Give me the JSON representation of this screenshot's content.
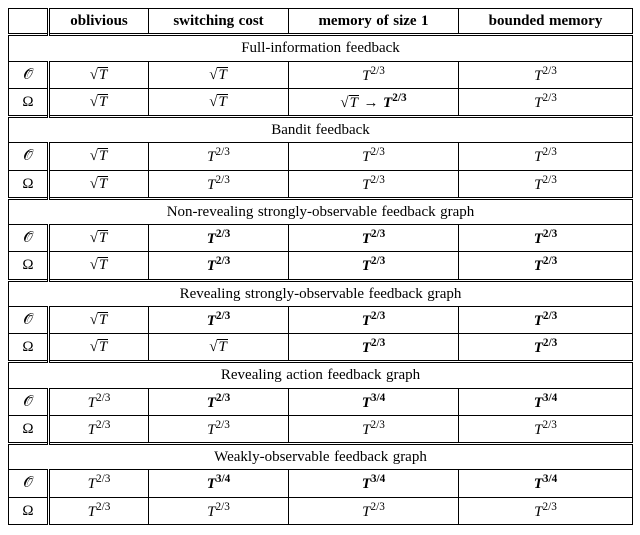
{
  "chart_data": {
    "type": "table",
    "columns": [
      "oblivious",
      "switching cost",
      "memory of size 1",
      "bounded memory"
    ],
    "row_labels": [
      "𝒪̃",
      "Ω"
    ],
    "sections": [
      {
        "title": "Full-information feedback",
        "rows": [
          [
            "√T",
            "√T",
            "T^{2/3}",
            "T^{2/3}"
          ],
          [
            "√T",
            "√T",
            "√T → T^{2/3}",
            "T^{2/3}"
          ]
        ],
        "bold": [
          [],
          [
            [
              2
            ]
          ]
        ]
      },
      {
        "title": "Bandit feedback",
        "rows": [
          [
            "√T",
            "T^{2/3}",
            "T^{2/3}",
            "T^{2/3}"
          ],
          [
            "√T",
            "T^{2/3}",
            "T^{2/3}",
            "T^{2/3}"
          ]
        ],
        "bold": [
          [],
          []
        ]
      },
      {
        "title": "Non-revealing strongly-observable feedback graph",
        "rows": [
          [
            "√T",
            "T^{2/3}",
            "T^{2/3}",
            "T^{2/3}"
          ],
          [
            "√T",
            "T^{2/3}",
            "T^{2/3}",
            "T^{2/3}"
          ]
        ],
        "bold": [
          [
            1,
            2,
            3
          ],
          [
            1,
            2,
            3
          ]
        ]
      },
      {
        "title": "Revealing strongly-observable feedback graph",
        "rows": [
          [
            "√T",
            "T^{2/3}",
            "T^{2/3}",
            "T^{2/3}"
          ],
          [
            "√T",
            "√T",
            "T^{2/3}",
            "T^{2/3}"
          ]
        ],
        "bold": [
          [
            1,
            2,
            3
          ],
          [
            2,
            3
          ]
        ]
      },
      {
        "title": "Revealing action feedback graph",
        "rows": [
          [
            "T^{2/3}",
            "T^{2/3}",
            "T^{3/4}",
            "T^{3/4}"
          ],
          [
            "T^{2/3}",
            "T^{2/3}",
            "T^{2/3}",
            "T^{2/3}"
          ]
        ],
        "bold": [
          [
            1,
            2,
            3
          ],
          []
        ]
      },
      {
        "title": "Weakly-observable feedback graph",
        "rows": [
          [
            "T^{2/3}",
            "T^{3/4}",
            "T^{3/4}",
            "T^{3/4}"
          ],
          [
            "T^{2/3}",
            "T^{2/3}",
            "T^{2/3}",
            "T^{2/3}"
          ]
        ],
        "bold": [
          [
            1,
            2,
            3
          ],
          []
        ]
      }
    ]
  },
  "header": {
    "c1": "oblivious",
    "c2": "switching cost",
    "c3": "memory of size 1",
    "c4": "bounded memory"
  },
  "sym": {
    "Otilde": "𝒪̃",
    "Omega": "Ω",
    "arrow": "→"
  },
  "exp": {
    "e23": "2/3",
    "e34": "3/4"
  },
  "lbl": {
    "T": "T"
  },
  "sections": {
    "s0": "Full-information feedback",
    "s1": "Bandit feedback",
    "s2": "Non-revealing strongly-observable feedback graph",
    "s3": "Revealing strongly-observable feedback graph",
    "s4": "Revealing action feedback graph",
    "s5": "Weakly-observable feedback graph"
  }
}
